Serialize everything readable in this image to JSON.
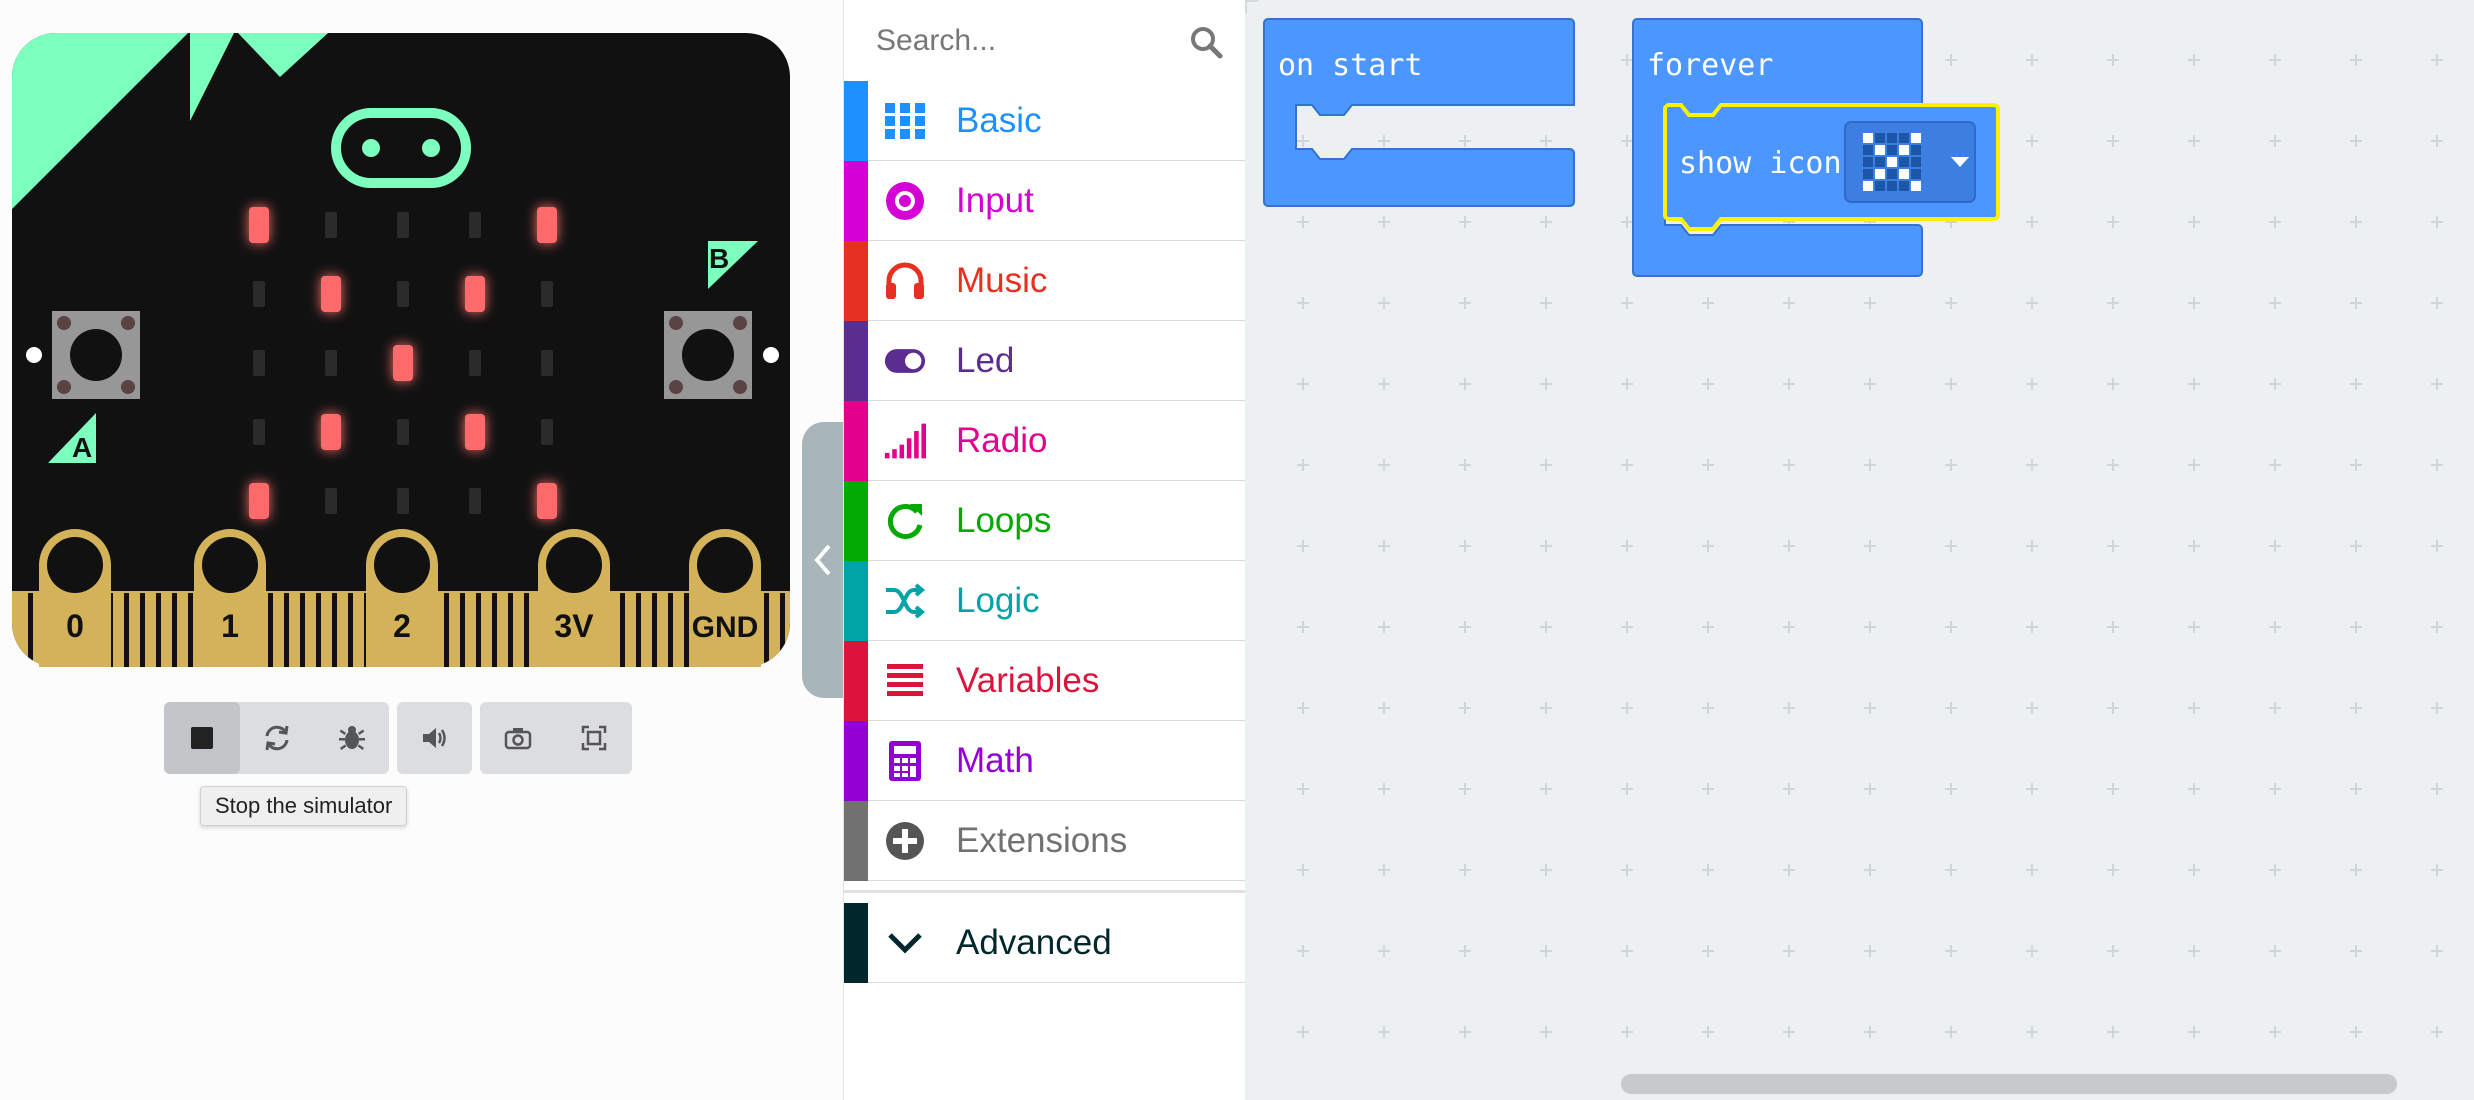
{
  "simulator": {
    "pins": [
      "0",
      "1",
      "2",
      "3V",
      "GND"
    ],
    "button_a": "A",
    "button_b": "B",
    "led_matrix": [
      [
        1,
        0,
        0,
        0,
        1
      ],
      [
        0,
        1,
        0,
        1,
        0
      ],
      [
        0,
        0,
        1,
        0,
        0
      ],
      [
        0,
        1,
        0,
        1,
        0
      ],
      [
        1,
        0,
        0,
        0,
        1
      ]
    ],
    "controls": [
      "stop-icon",
      "restart-icon",
      "debug-icon",
      "mute-icon",
      "screenshot-icon",
      "fullscreen-icon"
    ],
    "tooltip": "Stop the simulator"
  },
  "toolbox": {
    "search_placeholder": "Search...",
    "categories": [
      {
        "label": "Basic",
        "color": "#1e90ff",
        "icon": "grid-icon"
      },
      {
        "label": "Input",
        "color": "#d400d4",
        "icon": "input-icon"
      },
      {
        "label": "Music",
        "color": "#e63022",
        "icon": "headphones-icon"
      },
      {
        "label": "Led",
        "color": "#5c2d91",
        "icon": "toggle-icon"
      },
      {
        "label": "Radio",
        "color": "#e3008c",
        "icon": "signal-icon"
      },
      {
        "label": "Loops",
        "color": "#00aa00",
        "icon": "loop-icon"
      },
      {
        "label": "Logic",
        "color": "#00a4a6",
        "icon": "shuffle-icon"
      },
      {
        "label": "Variables",
        "color": "#dc143c",
        "icon": "list-icon"
      },
      {
        "label": "Math",
        "color": "#9400d3",
        "icon": "calculator-icon"
      },
      {
        "label": "Extensions",
        "color": "#717171",
        "icon": "plus-circle-icon"
      }
    ],
    "advanced": {
      "label": "Advanced",
      "color": "#00272b",
      "icon": "chevron-down-icon"
    }
  },
  "workspace": {
    "on_start_label": "on start",
    "forever_label": "forever",
    "show_icon_label": "show icon",
    "block_color": "#4c97ff",
    "icon_preview": [
      [
        1,
        0,
        0,
        0,
        1
      ],
      [
        0,
        1,
        0,
        1,
        0
      ],
      [
        0,
        0,
        1,
        0,
        0
      ],
      [
        0,
        1,
        0,
        1,
        0
      ],
      [
        1,
        0,
        0,
        0,
        1
      ]
    ]
  }
}
